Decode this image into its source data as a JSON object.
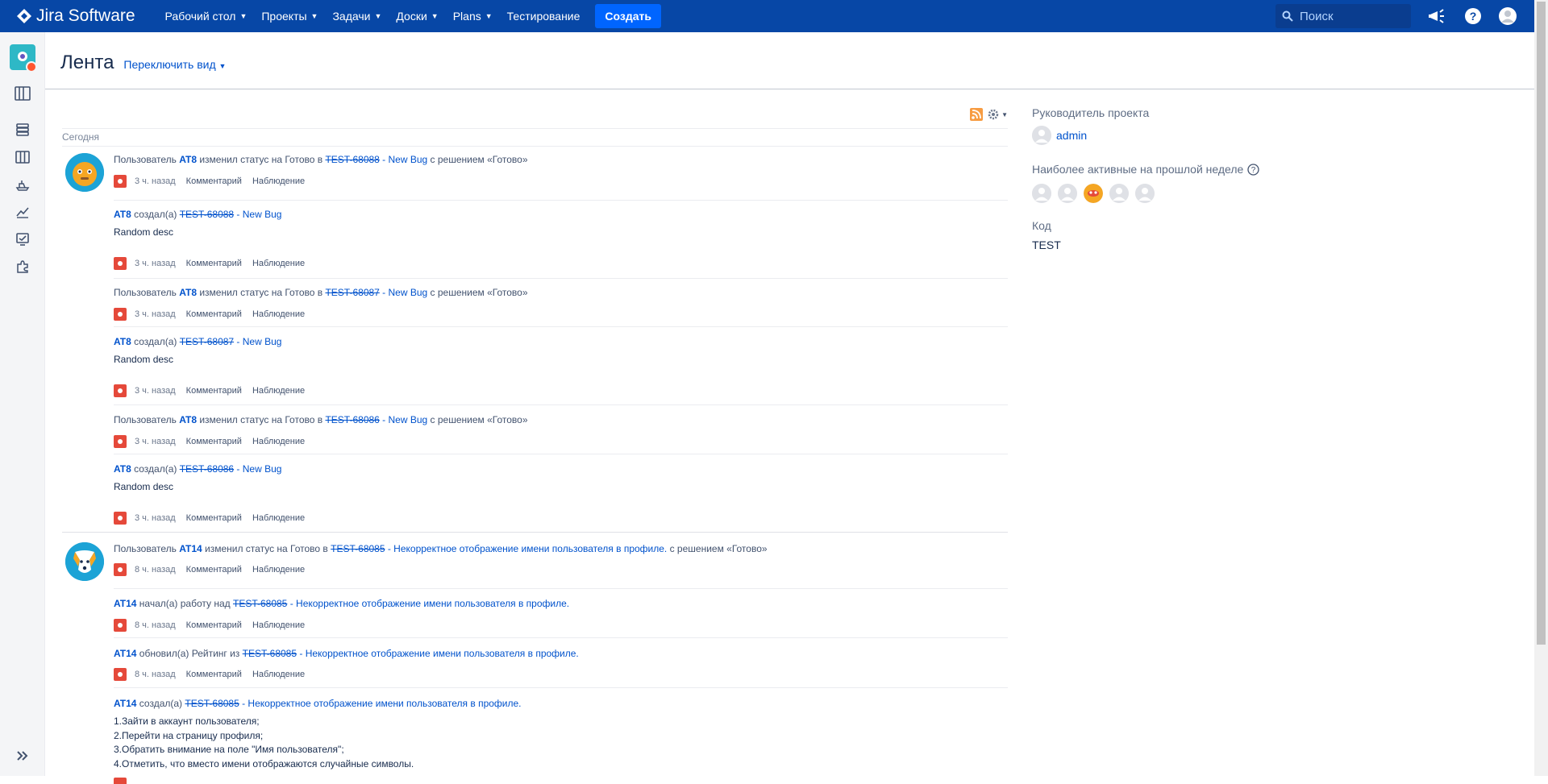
{
  "nav": {
    "logo_text": "Jira Software",
    "menu": [
      {
        "label": "Рабочий стол",
        "chevron": true
      },
      {
        "label": "Проекты",
        "chevron": true
      },
      {
        "label": "Задачи",
        "chevron": true
      },
      {
        "label": "Доски",
        "chevron": true
      },
      {
        "label": "Plans",
        "chevron": true
      },
      {
        "label": "Тестирование",
        "chevron": false
      }
    ],
    "create_label": "Создать",
    "search_placeholder": "Поиск"
  },
  "page": {
    "title": "Лента",
    "switch_view": "Переключить вид"
  },
  "feed": {
    "today_label": "Сегодня",
    "time_3h": "3 ч. назад",
    "time_8h": "8 ч. назад",
    "comment_label": "Комментарий",
    "watch_label": "Наблюдение",
    "items": [
      {
        "pre": "Пользователь ",
        "user": "AT8",
        "mid": " изменил статус на Готово в ",
        "key": "TEST-68088",
        "summary": " - New Bug",
        "post": " с решением «Готово»",
        "desc": "",
        "time": "3 ч. назад"
      },
      {
        "pre": "",
        "user": "AT8",
        "mid": " создал(а) ",
        "key": "TEST-68088",
        "summary": " - New Bug",
        "post": "",
        "desc": "Random desc",
        "time": "3 ч. назад"
      },
      {
        "pre": "Пользователь ",
        "user": "AT8",
        "mid": " изменил статус на Готово в ",
        "key": "TEST-68087",
        "summary": " - New Bug",
        "post": " с решением «Готово»",
        "desc": "",
        "time": "3 ч. назад"
      },
      {
        "pre": "",
        "user": "AT8",
        "mid": " создал(а) ",
        "key": "TEST-68087",
        "summary": " - New Bug",
        "post": "",
        "desc": "Random desc",
        "time": "3 ч. назад"
      },
      {
        "pre": "Пользователь ",
        "user": "AT8",
        "mid": " изменил статус на Готово в ",
        "key": "TEST-68086",
        "summary": " - New Bug",
        "post": " с решением «Готово»",
        "desc": "",
        "time": "3 ч. назад"
      },
      {
        "pre": "",
        "user": "AT8",
        "mid": " создал(а) ",
        "key": "TEST-68086",
        "summary": " - New Bug",
        "post": "",
        "desc": "Random desc",
        "time": "3 ч. назад"
      },
      {
        "pre": "Пользователь ",
        "user": "AT14",
        "mid": " изменил статус на Готово в ",
        "key": "TEST-68085",
        "summary": " - Некорректное отображение имени пользователя в профиле.",
        "post": " с решением «Готово»",
        "desc": "",
        "time": "8 ч. назад"
      },
      {
        "pre": "",
        "user": "AT14",
        "mid": " начал(а) работу над ",
        "key": "TEST-68085",
        "summary": " - Некорректное отображение имени пользователя в профиле.",
        "post": "",
        "desc": "",
        "time": "8 ч. назад"
      },
      {
        "pre": "",
        "user": "AT14",
        "mid": " обновил(а) Рейтинг из ",
        "key": "TEST-68085",
        "summary": " - Некорректное отображение имени пользователя в профиле.",
        "post": "",
        "desc": "",
        "time": "8 ч. назад"
      },
      {
        "pre": "",
        "user": "AT14",
        "mid": " создал(а) ",
        "key": "TEST-68085",
        "summary": " - Некорректное отображение имени пользователя в профиле.",
        "post": "",
        "desc": "",
        "time": "8 ч. назад"
      }
    ],
    "steps": [
      "1.Зайти в аккаунт пользователя;",
      "2.Перейти на страницу профиля;",
      "3.Обратить внимание на поле \"Имя пользователя\";",
      "4.Отметить, что вместо имени отображаются случайные символы."
    ]
  },
  "right_panel": {
    "lead_label": "Руководитель проекта",
    "lead_name": "admin",
    "active_label": "Наиболее активные на прошлой неделе",
    "code_label": "Код",
    "code_value": "TEST"
  },
  "colors": {
    "nav_bg": "#0747a6",
    "link": "#0052cc",
    "bug": "#e5493a",
    "create": "#0065ff"
  }
}
